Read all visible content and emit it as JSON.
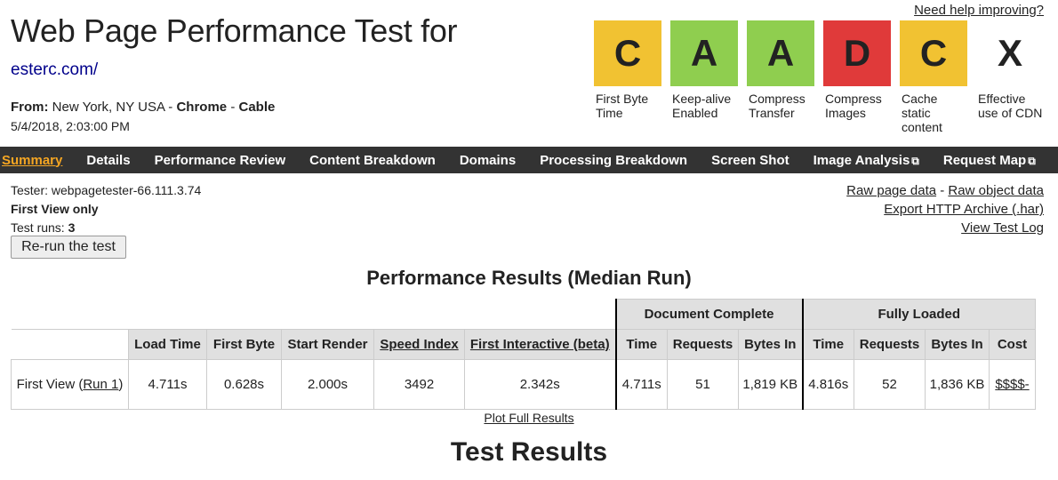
{
  "header": {
    "title": "Web Page Performance Test for",
    "url": "esterc.com/",
    "from_label": "From:",
    "location": "New York, NY USA",
    "sep1": "-",
    "browser": "Chrome",
    "sep2": "-",
    "connection": "Cable",
    "date": "5/4/2018, 2:03:00 PM",
    "help_link": "Need help improving?"
  },
  "grades": [
    {
      "grade": "C",
      "label": "First Byte Time",
      "color": "#f1c232"
    },
    {
      "grade": "A",
      "label": "Keep-alive Enabled",
      "color": "#8fce4f"
    },
    {
      "grade": "A",
      "label": "Compress Transfer",
      "color": "#8fce4f"
    },
    {
      "grade": "D",
      "label": "Compress Images",
      "color": "#e03a3a"
    },
    {
      "grade": "C",
      "label": "Cache static content",
      "color": "#f1c232"
    },
    {
      "grade": "X",
      "label": "Effective use of CDN",
      "color": "#ffffff"
    }
  ],
  "nav": {
    "summary": "Summary",
    "details": "Details",
    "performance_review": "Performance Review",
    "content_breakdown": "Content Breakdown",
    "domains": "Domains",
    "processing_breakdown": "Processing Breakdown",
    "screen_shot": "Screen Shot",
    "image_analysis": "Image Analysis",
    "request_map": "Request Map",
    "external_icon": "external-link-icon"
  },
  "tester": {
    "tester_line": "Tester: webpagetester-66.111.3.74",
    "view_mode": "First View only",
    "runs_label": "Test runs:",
    "runs_value": "3",
    "rerun_button": "Re-run the test"
  },
  "links": {
    "raw_page": "Raw page data",
    "dash": "-",
    "raw_object": "Raw object data",
    "export_har": "Export HTTP Archive (.har)",
    "view_log": "View Test Log"
  },
  "results": {
    "title": "Performance Results (Median Run)",
    "group_document": "Document Complete",
    "group_fully": "Fully Loaded",
    "headers": {
      "load_time": "Load Time",
      "first_byte": "First Byte",
      "start_render": "Start Render",
      "speed_index": "Speed Index",
      "first_interactive": "First Interactive (beta)",
      "doc_time": "Time",
      "doc_requests": "Requests",
      "doc_bytes": "Bytes In",
      "full_time": "Time",
      "full_requests": "Requests",
      "full_bytes": "Bytes In",
      "cost": "Cost"
    },
    "row": {
      "label_prefix": "First View (",
      "run_link": "Run 1",
      "label_suffix": ")",
      "load_time": "4.711s",
      "first_byte": "0.628s",
      "start_render": "2.000s",
      "speed_index": "3492",
      "first_interactive": "2.342s",
      "doc_time": "4.711s",
      "doc_requests": "51",
      "doc_bytes": "1,819 KB",
      "full_time": "4.816s",
      "full_requests": "52",
      "full_bytes": "1,836 KB",
      "cost": "$$$$-"
    },
    "plot_link": "Plot Full Results"
  },
  "section_title": "Test Results"
}
